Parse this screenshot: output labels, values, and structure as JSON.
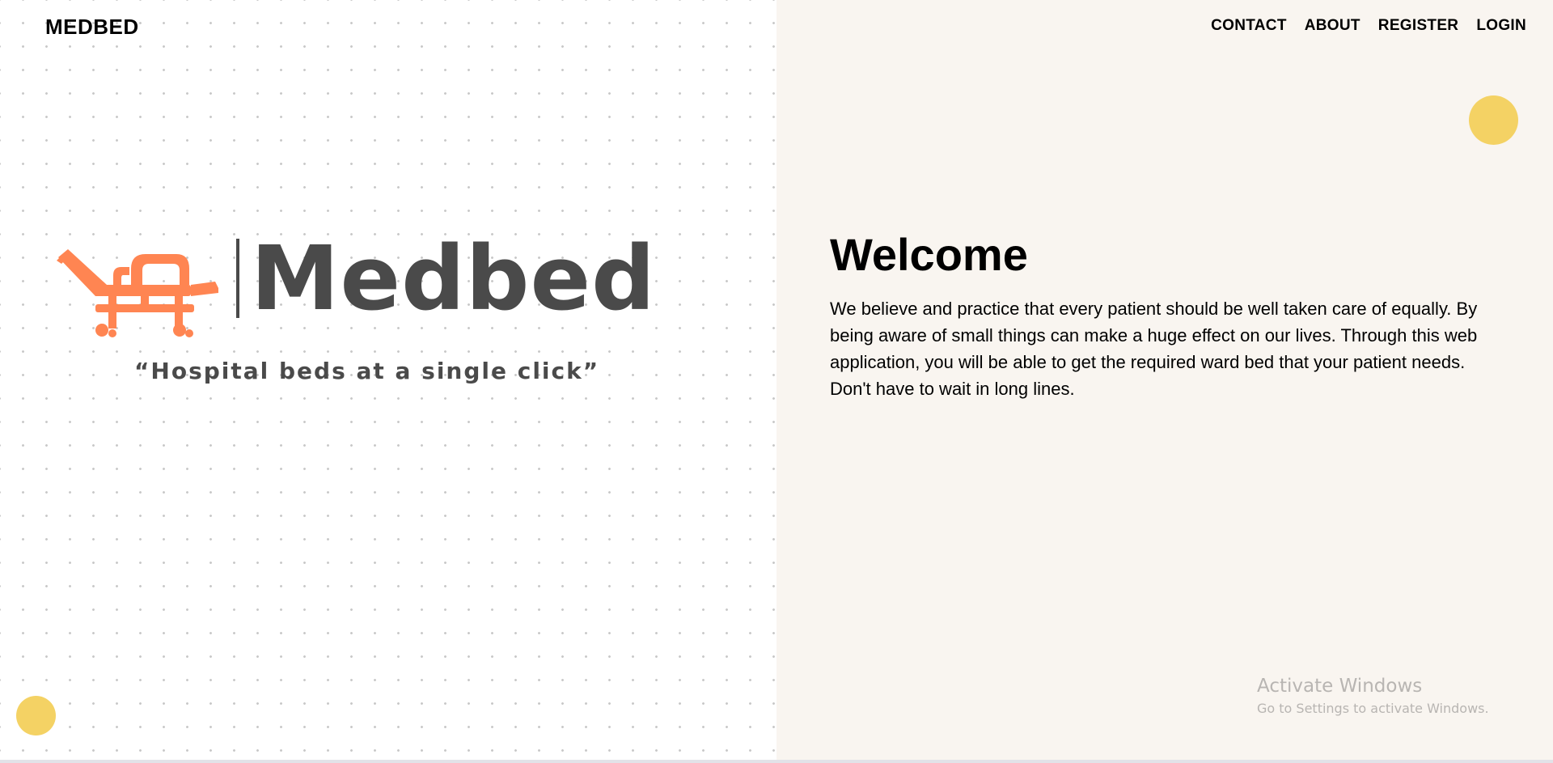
{
  "header": {
    "brand": "MEDBED",
    "nav": [
      {
        "label": "CONTACT"
      },
      {
        "label": "ABOUT"
      },
      {
        "label": "REGISTER"
      },
      {
        "label": "LOGIN"
      }
    ]
  },
  "logo": {
    "wordmark": "Medbed",
    "tagline": "“Hospital beds at a single click”",
    "icon": "hospital-bed-icon",
    "icon_color": "#ff8552",
    "text_color": "#4a4a4a"
  },
  "main": {
    "heading": "Welcome",
    "paragraph": "We believe and practice that every patient should be well taken care of equally. By being aware of small things can make a huge effect on our lives. Through this web application, you will be able to get the required ward bed that your patient needs. Don't have to wait in long lines."
  },
  "watermark": {
    "title": "Activate Windows",
    "subtitle": "Go to Settings to activate Windows."
  },
  "colors": {
    "accent_yellow": "#f4d264",
    "right_panel_bg": "#f9f5f0"
  }
}
